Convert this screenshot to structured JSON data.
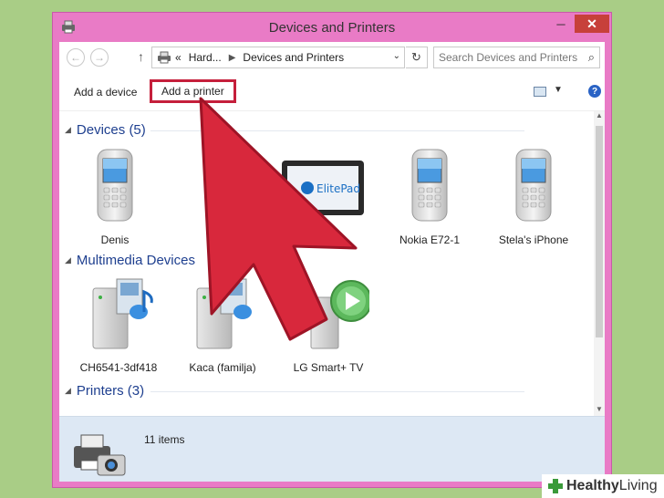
{
  "window": {
    "title": "Devices and Printers",
    "min_label": "─",
    "max_label": "□",
    "close_label": "✕"
  },
  "nav": {
    "back_glyph": "←",
    "forward_glyph": "→",
    "up_glyph": "↑"
  },
  "address": {
    "prefix": "«",
    "segments": [
      "Hard...",
      "Devices and Printers"
    ],
    "dropdown_glyph": "⌄",
    "refresh_glyph": "↻"
  },
  "search": {
    "placeholder": "Search Devices and Printers",
    "icon_glyph": "⌕"
  },
  "toolbar": {
    "add_device_label": "Add a device",
    "add_printer_label": "Add a printer",
    "view_dropdown_glyph": "▼",
    "help_glyph": "?",
    "highlight_color": "#c51f3b"
  },
  "groups": {
    "devices": {
      "chevron": "◢",
      "label": "Devices (5)"
    },
    "multimedia": {
      "chevron": "◢",
      "label": "Multimedia Devices"
    },
    "printers": {
      "chevron": "◢",
      "label": "Printers (3)"
    }
  },
  "devices": [
    {
      "icon": "mobile-phone-icon",
      "label": "Denis"
    },
    {
      "icon": "tablet-icon",
      "label": "",
      "brand": "ElitePad"
    },
    {
      "icon": "mobile-phone-icon",
      "label": "Nokia E72-1"
    },
    {
      "icon": "mobile-phone-icon",
      "label": "Stela's iPhone"
    }
  ],
  "multimedia": [
    {
      "icon": "media-server-icon",
      "label": "CH6541-3df418"
    },
    {
      "icon": "media-server-icon",
      "label": "Kaca (familja)"
    },
    {
      "icon": "media-player-icon",
      "label": "LG Smart+ TV"
    }
  ],
  "status": {
    "count_text": "11 items"
  },
  "scroll": {
    "up_glyph": "▲",
    "down_glyph": "▼"
  },
  "watermark": {
    "strong": "Healthy",
    "rest": " Living"
  },
  "colors": {
    "window_frame": "#e97bc6",
    "arrow": "#d8283c",
    "status_bg": "#dde8f4",
    "group_text": "#1e3f8f"
  }
}
